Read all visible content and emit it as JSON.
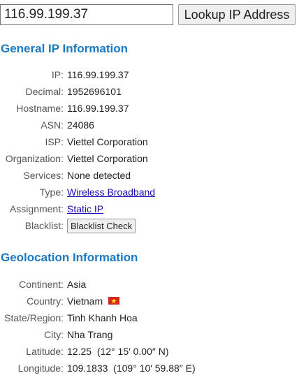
{
  "search": {
    "ip_value": "116.99.199.37",
    "button_label": "Lookup IP Address"
  },
  "general": {
    "title": "General IP Information",
    "ip_label": "IP:",
    "ip_value": "116.99.199.37",
    "decimal_label": "Decimal:",
    "decimal_value": "1952696101",
    "hostname_label": "Hostname:",
    "hostname_value": "116.99.199.37",
    "asn_label": "ASN:",
    "asn_value": "24086",
    "isp_label": "ISP:",
    "isp_value": "Viettel Corporation",
    "org_label": "Organization:",
    "org_value": "Viettel Corporation",
    "services_label": "Services:",
    "services_value": "None detected",
    "type_label": "Type:",
    "type_value": "Wireless Broadband",
    "assignment_label": "Assignment:",
    "assignment_value": "Static IP",
    "blacklist_label": "Blacklist:",
    "blacklist_button": "Blacklist Check"
  },
  "geo": {
    "title": "Geolocation Information",
    "continent_label": "Continent:",
    "continent_value": "Asia",
    "country_label": "Country:",
    "country_value": "Vietnam",
    "country_flag_icon": "vietnam-flag-icon",
    "region_label": "State/Region:",
    "region_value": "Tinh Khanh Hoa",
    "city_label": "City:",
    "city_value": "Nha Trang",
    "lat_label": "Latitude:",
    "lat_value": "12.25  (12° 15′ 0.00″ N)",
    "lon_label": "Longitude:",
    "lon_value": "109.1833  (109° 10′ 59.88″ E)"
  },
  "colors": {
    "section_title": "#1a79c4",
    "link": "#1a0dab",
    "label": "#555555",
    "flag_red": "#da251d",
    "flag_star": "#ffff00"
  }
}
